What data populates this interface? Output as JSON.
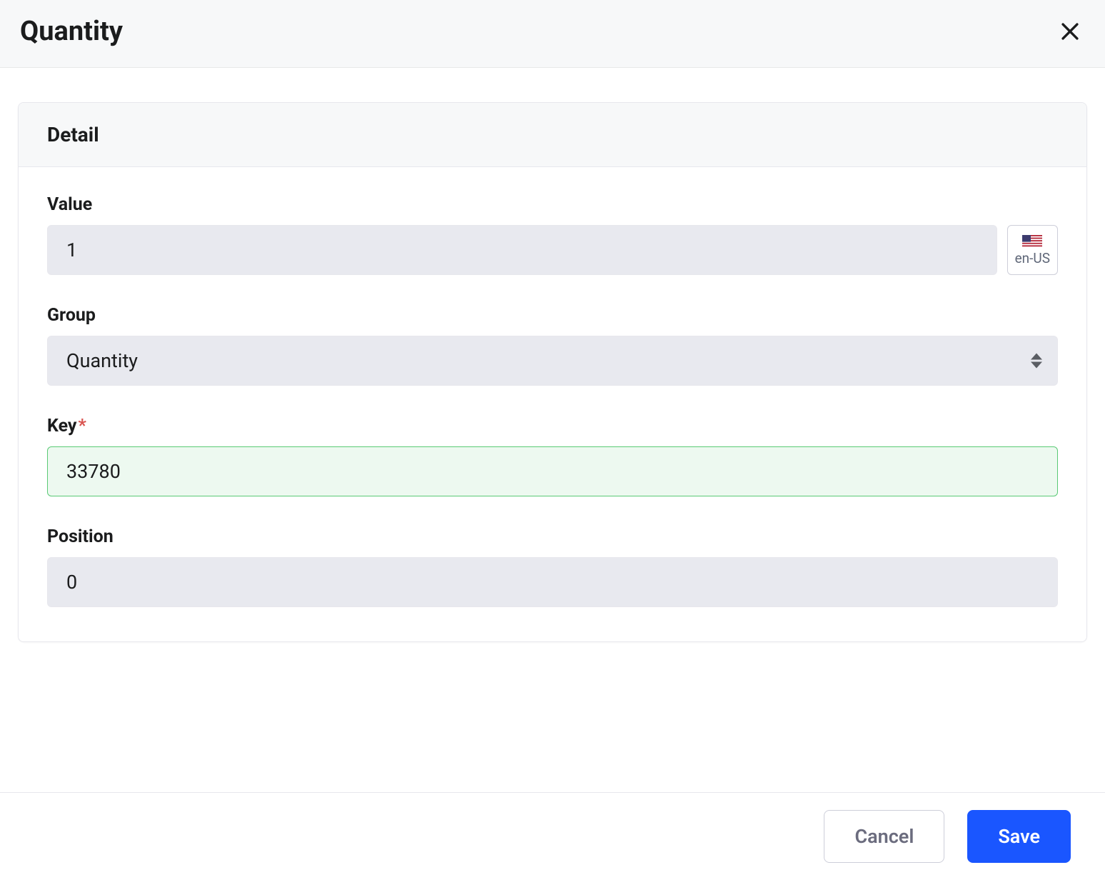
{
  "header": {
    "title": "Quantity"
  },
  "card": {
    "title": "Detail"
  },
  "form": {
    "valueLabel": "Value",
    "valueInput": "1",
    "locale": "en-US",
    "groupLabel": "Group",
    "groupSelected": "Quantity",
    "keyLabel": "Key",
    "keyInput": "33780",
    "positionLabel": "Position",
    "positionInput": "0"
  },
  "footer": {
    "cancel": "Cancel",
    "save": "Save"
  }
}
